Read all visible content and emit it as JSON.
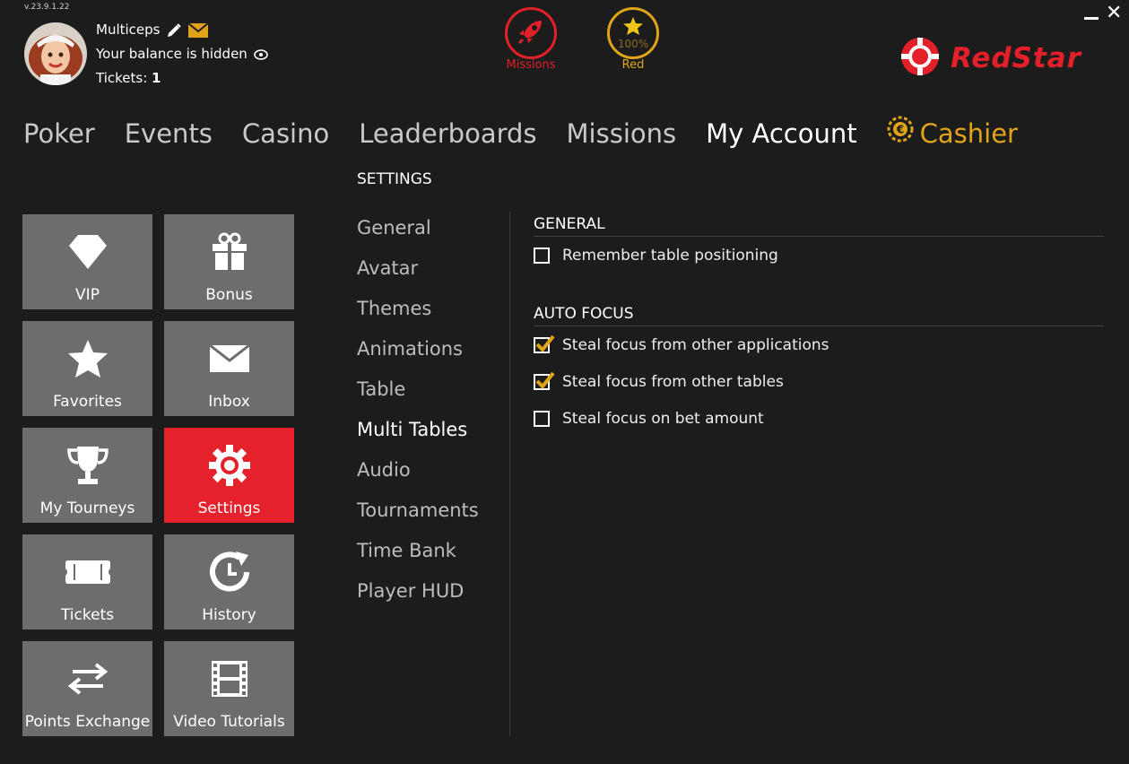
{
  "version": "v.23.9.1.22",
  "user": {
    "name": "Multiceps",
    "balance_text": "Your balance is hidden",
    "tickets_label": "Tickets:",
    "tickets_count": "1"
  },
  "badges": {
    "missions_label": "Missions",
    "red_label": "Red",
    "red_progress": "100%"
  },
  "brand": {
    "name": "RedStar",
    "color": "#e3202a"
  },
  "nav": {
    "items": [
      "Poker",
      "Events",
      "Casino",
      "Leaderboards",
      "Missions",
      "My Account"
    ],
    "active": "My Account",
    "cashier_label": "Cashier",
    "cashier_color": "#e1a418"
  },
  "tiles": [
    {
      "label": "VIP",
      "icon": "diamond-icon"
    },
    {
      "label": "Bonus",
      "icon": "gift-icon"
    },
    {
      "label": "Favorites",
      "icon": "star-icon"
    },
    {
      "label": "Inbox",
      "icon": "envelope-icon"
    },
    {
      "label": "My Tourneys",
      "icon": "trophy-icon"
    },
    {
      "label": "Settings",
      "icon": "gear-icon",
      "active": true
    },
    {
      "label": "Tickets",
      "icon": "ticket-icon"
    },
    {
      "label": "History",
      "icon": "history-icon"
    },
    {
      "label": "Points Exchange",
      "icon": "exchange-icon"
    },
    {
      "label": "Video Tutorials",
      "icon": "film-icon"
    }
  ],
  "settings": {
    "title": "SETTINGS",
    "menu": [
      "General",
      "Avatar",
      "Themes",
      "Animations",
      "Table",
      "Multi Tables",
      "Audio",
      "Tournaments",
      "Time Bank",
      "Player HUD"
    ],
    "active_menu": "Multi Tables",
    "sections": {
      "general": {
        "heading": "GENERAL",
        "options": [
          {
            "label": "Remember table positioning",
            "checked": false
          }
        ]
      },
      "auto_focus": {
        "heading": "AUTO FOCUS",
        "options": [
          {
            "label": "Steal focus from other applications",
            "checked": true
          },
          {
            "label": "Steal focus from other tables",
            "checked": true
          },
          {
            "label": "Steal focus on bet amount",
            "checked": false
          }
        ]
      }
    }
  },
  "colors": {
    "accent_red": "#e5212b",
    "accent_gold": "#e1a418",
    "tile_gray": "#6d6d6d",
    "background": "#1c1c1c"
  }
}
